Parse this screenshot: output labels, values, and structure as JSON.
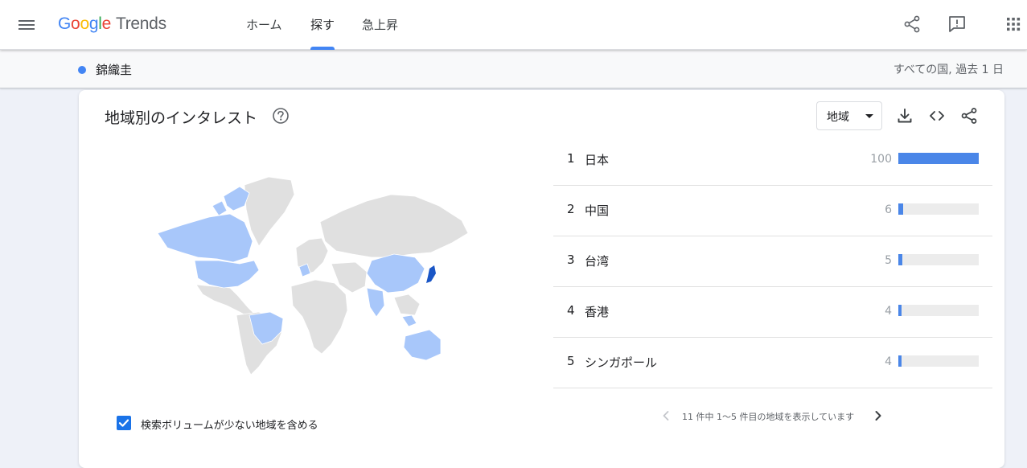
{
  "header": {
    "logo_google": [
      "G",
      "o",
      "o",
      "g",
      "l",
      "e"
    ],
    "logo_product": "Trends",
    "tabs": [
      {
        "label": "ホーム",
        "active": false
      },
      {
        "label": "探す",
        "active": true
      },
      {
        "label": "急上昇",
        "active": false
      }
    ],
    "icons": [
      "share-icon",
      "feedback-icon",
      "apps-icon"
    ]
  },
  "term_bar": {
    "term": "錦織圭",
    "term_color": "#4285f4",
    "scope": "すべての国, 過去 1 日"
  },
  "card": {
    "title": "地域別のインタレスト",
    "region_select": "地域",
    "icons": [
      "help-icon",
      "download-icon",
      "embed-icon",
      "share-icon"
    ],
    "rows": [
      {
        "rank": "1",
        "name": "日本",
        "value": "100",
        "fill": 1.0
      },
      {
        "rank": "2",
        "name": "中国",
        "value": "6",
        "fill": 0.06
      },
      {
        "rank": "3",
        "name": "台湾",
        "value": "5",
        "fill": 0.05
      },
      {
        "rank": "4",
        "name": "香港",
        "value": "4",
        "fill": 0.04
      },
      {
        "rank": "5",
        "name": "シンガポール",
        "value": "4",
        "fill": 0.04
      }
    ],
    "pager_text": "11 件中 1〜5 件目の地域を表示しています",
    "checkbox_label": "検索ボリュームが少ない地域を含める",
    "checkbox_checked": true
  },
  "colors": {
    "accent": "#4285f4",
    "bar": "#4a86e8",
    "map_highlight": "#a8c7fa",
    "map_strong": "#1a56c6",
    "map_neutral": "#e0e0e0"
  }
}
